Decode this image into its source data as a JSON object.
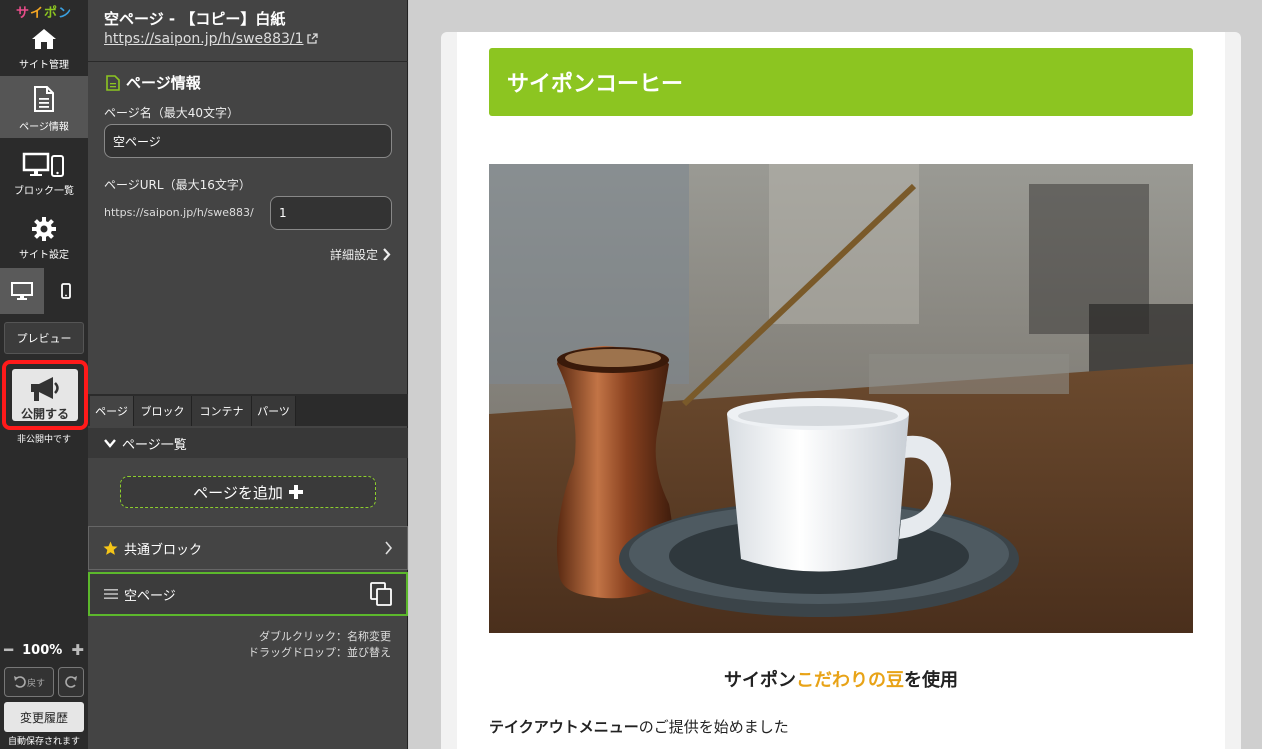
{
  "rail": {
    "logo": "サイポン",
    "logo_colors": [
      "#e94d8a",
      "#f5a623",
      "#8cc521",
      "#3aa0e0"
    ],
    "items": [
      {
        "label": "サイト管理",
        "icon": "home-icon"
      },
      {
        "label": "ページ情報",
        "icon": "document-icon"
      },
      {
        "label": "ブロック一覧",
        "icon": "devices-icon"
      },
      {
        "label": "サイト設定",
        "icon": "gear-icon"
      }
    ],
    "preview_label": "プレビュー",
    "publish_label": "公開する",
    "publish_status": "非公開中です",
    "zoom_label": "100%",
    "undo_label": "戻す",
    "history_label": "変更履歴",
    "autosave_label": "自動保存されます"
  },
  "panel": {
    "title": "空ページ - 【コピー】白紙",
    "url_link": "https://saipon.jp/h/swe883/1",
    "section_heading": "ページ情報",
    "page_name_label": "ページ名（最大40文字）",
    "page_name_value": "空ページ",
    "page_url_label": "ページURL（最大16文字）",
    "url_prefix": "https://saipon.jp/h/swe883/",
    "url_value": "1",
    "detail_settings": "詳細設定",
    "tabs": [
      "ページ",
      "ブロック",
      "コンテナ",
      "パーツ"
    ],
    "list_heading": "ページ一覧",
    "add_page_label": "ページを追加",
    "common_block_label": "共通ブロック",
    "blank_page_label": "空ページ",
    "hint_line1": "ダブルクリック：名称変更",
    "hint_line2": "ドラッグドロップ：並び替え"
  },
  "preview": {
    "site_title": "サイポンコーヒー",
    "headline_pre": "サイポン",
    "headline_accent": "こだわりの豆",
    "headline_post": "を使用",
    "subtext_bold": "テイクアウトメニュー",
    "subtext_rest": "のご提供を始めました"
  },
  "colors": {
    "accent_green": "#8cc521",
    "publish_highlight": "#ff1a1a",
    "headline_accent": "#e8a317"
  }
}
